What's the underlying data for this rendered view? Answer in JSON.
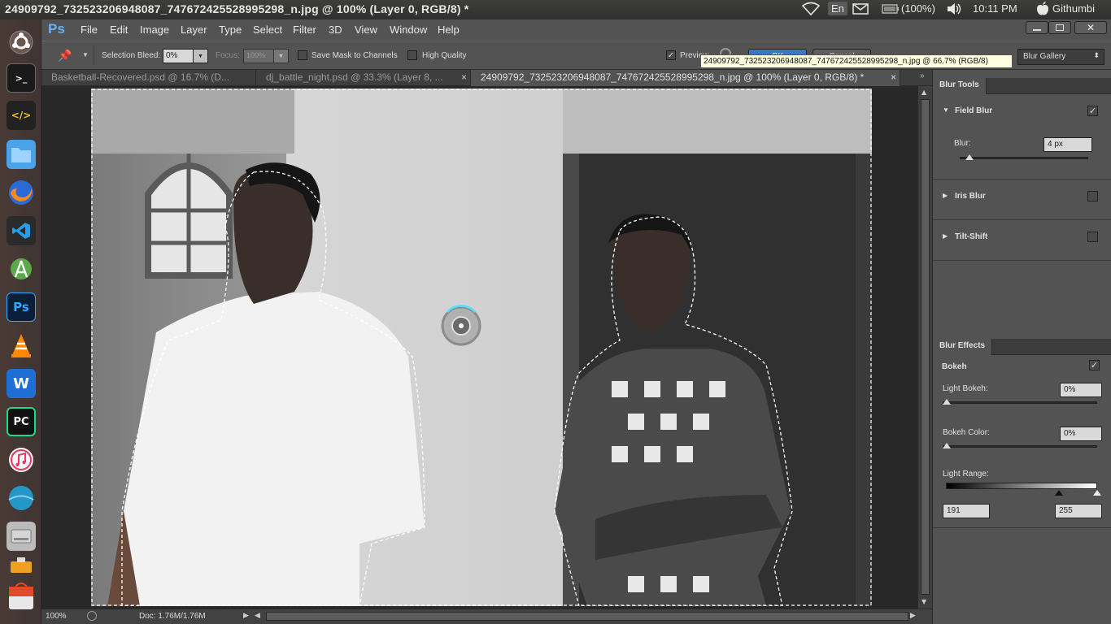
{
  "system": {
    "window_title": "24909792_732523206948087_747672425528995298_n.jpg @ 100% (Layer 0, RGB/8) *",
    "lang": "En",
    "battery": "(100%)",
    "time": "10:11 PM",
    "user": "Githumbi"
  },
  "launcher": {
    "apps": [
      "ubuntu-dash",
      "terminal",
      "code-editor",
      "files",
      "firefox",
      "vscode",
      "android-studio",
      "photoshop",
      "vlc",
      "wps-writer",
      "pycharm",
      "itunes",
      "unknown-app",
      "disk-drive",
      "usb-drive",
      "software-center"
    ],
    "ps_label": "Ps",
    "pc_label": "PC",
    "w_label": "W"
  },
  "menubar": {
    "logo": "Ps",
    "items": [
      "File",
      "Edit",
      "Image",
      "Layer",
      "Type",
      "Select",
      "Filter",
      "3D",
      "View",
      "Window",
      "Help"
    ]
  },
  "options": {
    "selection_bleed_label": "Selection Bleed:",
    "selection_bleed_value": "0%",
    "focus_label": "Focus:",
    "focus_value": "100%",
    "save_mask_label": "Save Mask to Channels",
    "high_quality_label": "High Quality",
    "preview_label": "Preview",
    "ok_label": "OK",
    "cancel_label": "Cancel",
    "workspace_value": "Blur Gallery"
  },
  "tooltip": "24909792_732523206948087_747672425528995298_n.jpg @ 66.7% (RGB/8)",
  "tabs": [
    {
      "label": "Basketball-Recovered.psd @ 16.7% (D...",
      "active": false
    },
    {
      "label": "dj_battle_night.psd @ 33.3% (Layer 8, ...",
      "active": false
    },
    {
      "label": "24909792_732523206948087_747672425528995298_n.jpg @ 100% (Layer 0, RGB/8) *",
      "active": true
    }
  ],
  "status": {
    "zoom": "100%",
    "doc": "Doc: 1.76M/1.76M"
  },
  "blur_tools": {
    "title": "Blur Tools",
    "field_blur": {
      "label": "Field Blur",
      "checked": true,
      "blur_label": "Blur:",
      "blur_value": "4 px",
      "slider": 0.05
    },
    "iris_blur": {
      "label": "Iris Blur",
      "checked": false
    },
    "tilt_shift": {
      "label": "Tilt-Shift",
      "checked": false
    }
  },
  "blur_effects": {
    "title": "Blur Effects",
    "bokeh_label": "Bokeh",
    "bokeh_checked": true,
    "light_bokeh_label": "Light Bokeh:",
    "light_bokeh_value": "0%",
    "bokeh_color_label": "Bokeh Color:",
    "bokeh_color_value": "0%",
    "light_range_label": "Light Range:",
    "light_range_low": "191",
    "light_range_high": "255"
  }
}
